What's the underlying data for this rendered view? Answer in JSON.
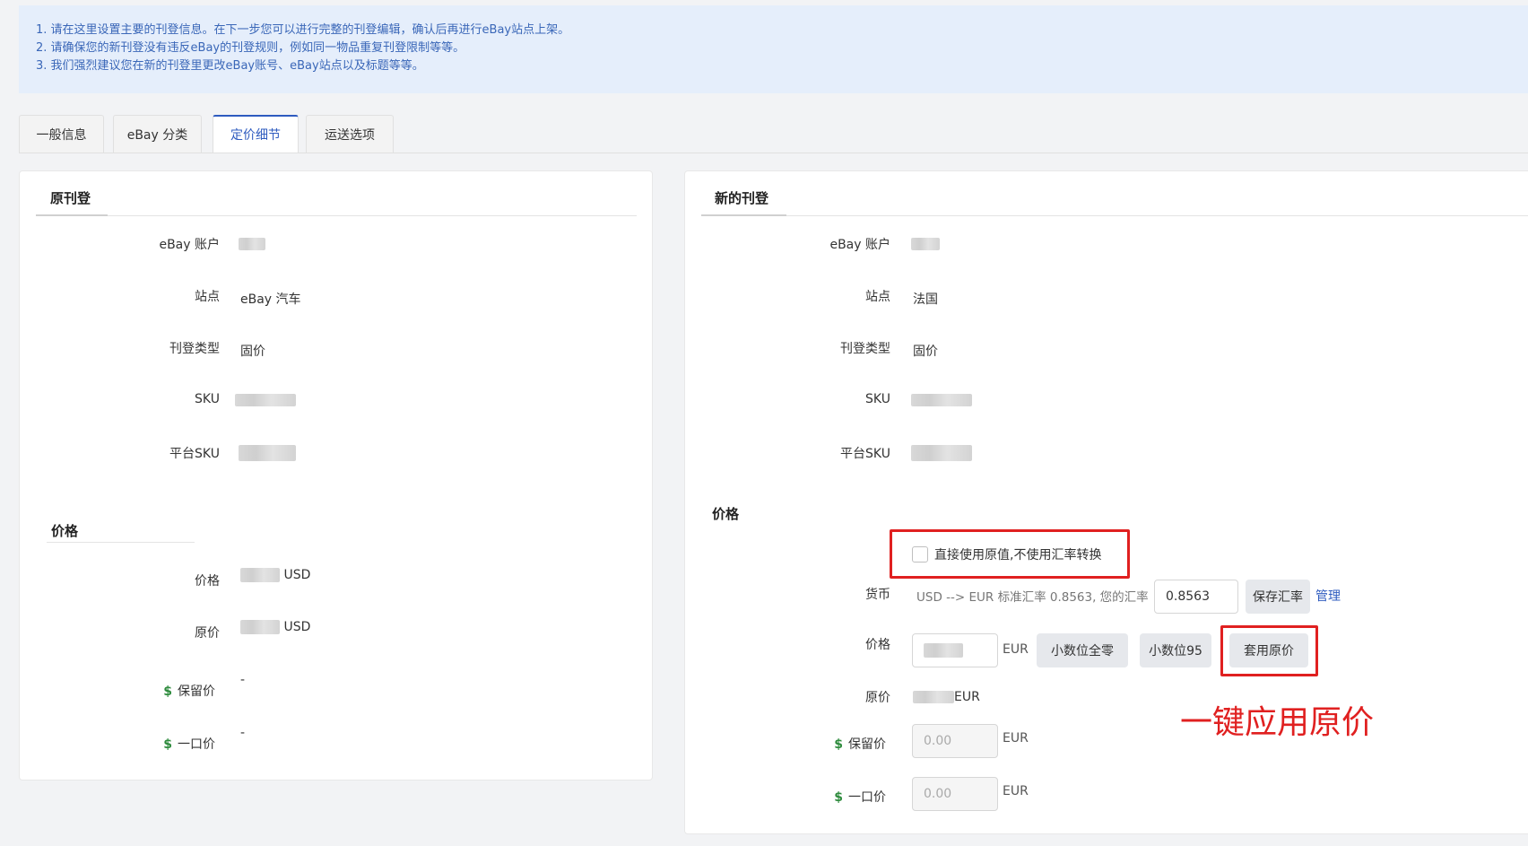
{
  "notice": [
    "1. 请在这里设置主要的刊登信息。在下一步您可以进行完整的刊登编辑，确认后再进行eBay站点上架。",
    "2. 请确保您的新刊登没有违反eBay的刊登规则，例如同一物品重复刊登限制等等。",
    "3. 我们强烈建议您在新的刊登里更改eBay账号、eBay站点以及标题等等。"
  ],
  "tabs": [
    "一般信息",
    "eBay 分类",
    "定价细节",
    "运送选项"
  ],
  "original": {
    "title": "原刊登",
    "labels": {
      "account": "eBay 账户",
      "site": "站点",
      "listing_type": "刊登类型",
      "sku": "SKU",
      "platform_sku": "平台SKU"
    },
    "site_value": "eBay 汽车",
    "listing_type_value": "固价",
    "price_section": "价格",
    "price_label": "价格",
    "price_currency": "USD",
    "orig_price_label": "原价",
    "orig_price_currency": "USD",
    "reserve_label": "保留价",
    "reserve_value": "-",
    "bin_label": "一口价",
    "bin_value": "-"
  },
  "new": {
    "title": "新的刊登",
    "labels": {
      "account": "eBay 账户",
      "site": "站点",
      "listing_type": "刊登类型",
      "sku": "SKU",
      "platform_sku": "平台SKU"
    },
    "site_value": "法国",
    "listing_type_value": "固价",
    "price_section": "价格",
    "direct_use_label": "直接使用原值,不使用汇率转换",
    "currency_label": "货币",
    "currency_text": "USD --> EUR 标准汇率 0.8563, 您的汇率",
    "rate_value": "0.8563",
    "save_rate": "保存汇率",
    "manage": "管理",
    "price_label": "价格",
    "price_currency": "EUR",
    "btn_zero": "小数位全零",
    "btn_95": "小数位95",
    "btn_apply": "套用原价",
    "orig_price_label": "原价",
    "orig_price_currency": "EUR",
    "reserve_label": "保留价",
    "reserve_placeholder": "0.00",
    "reserve_currency": "EUR",
    "bin_label": "一口价",
    "bin_placeholder": "0.00",
    "bin_currency": "EUR"
  },
  "dollar_sign": "$",
  "annotation": "一键应用原价",
  "colors": {
    "accent": "#2e5bbf",
    "highlight": "#e02020",
    "dollar": "#2e8b3d"
  }
}
